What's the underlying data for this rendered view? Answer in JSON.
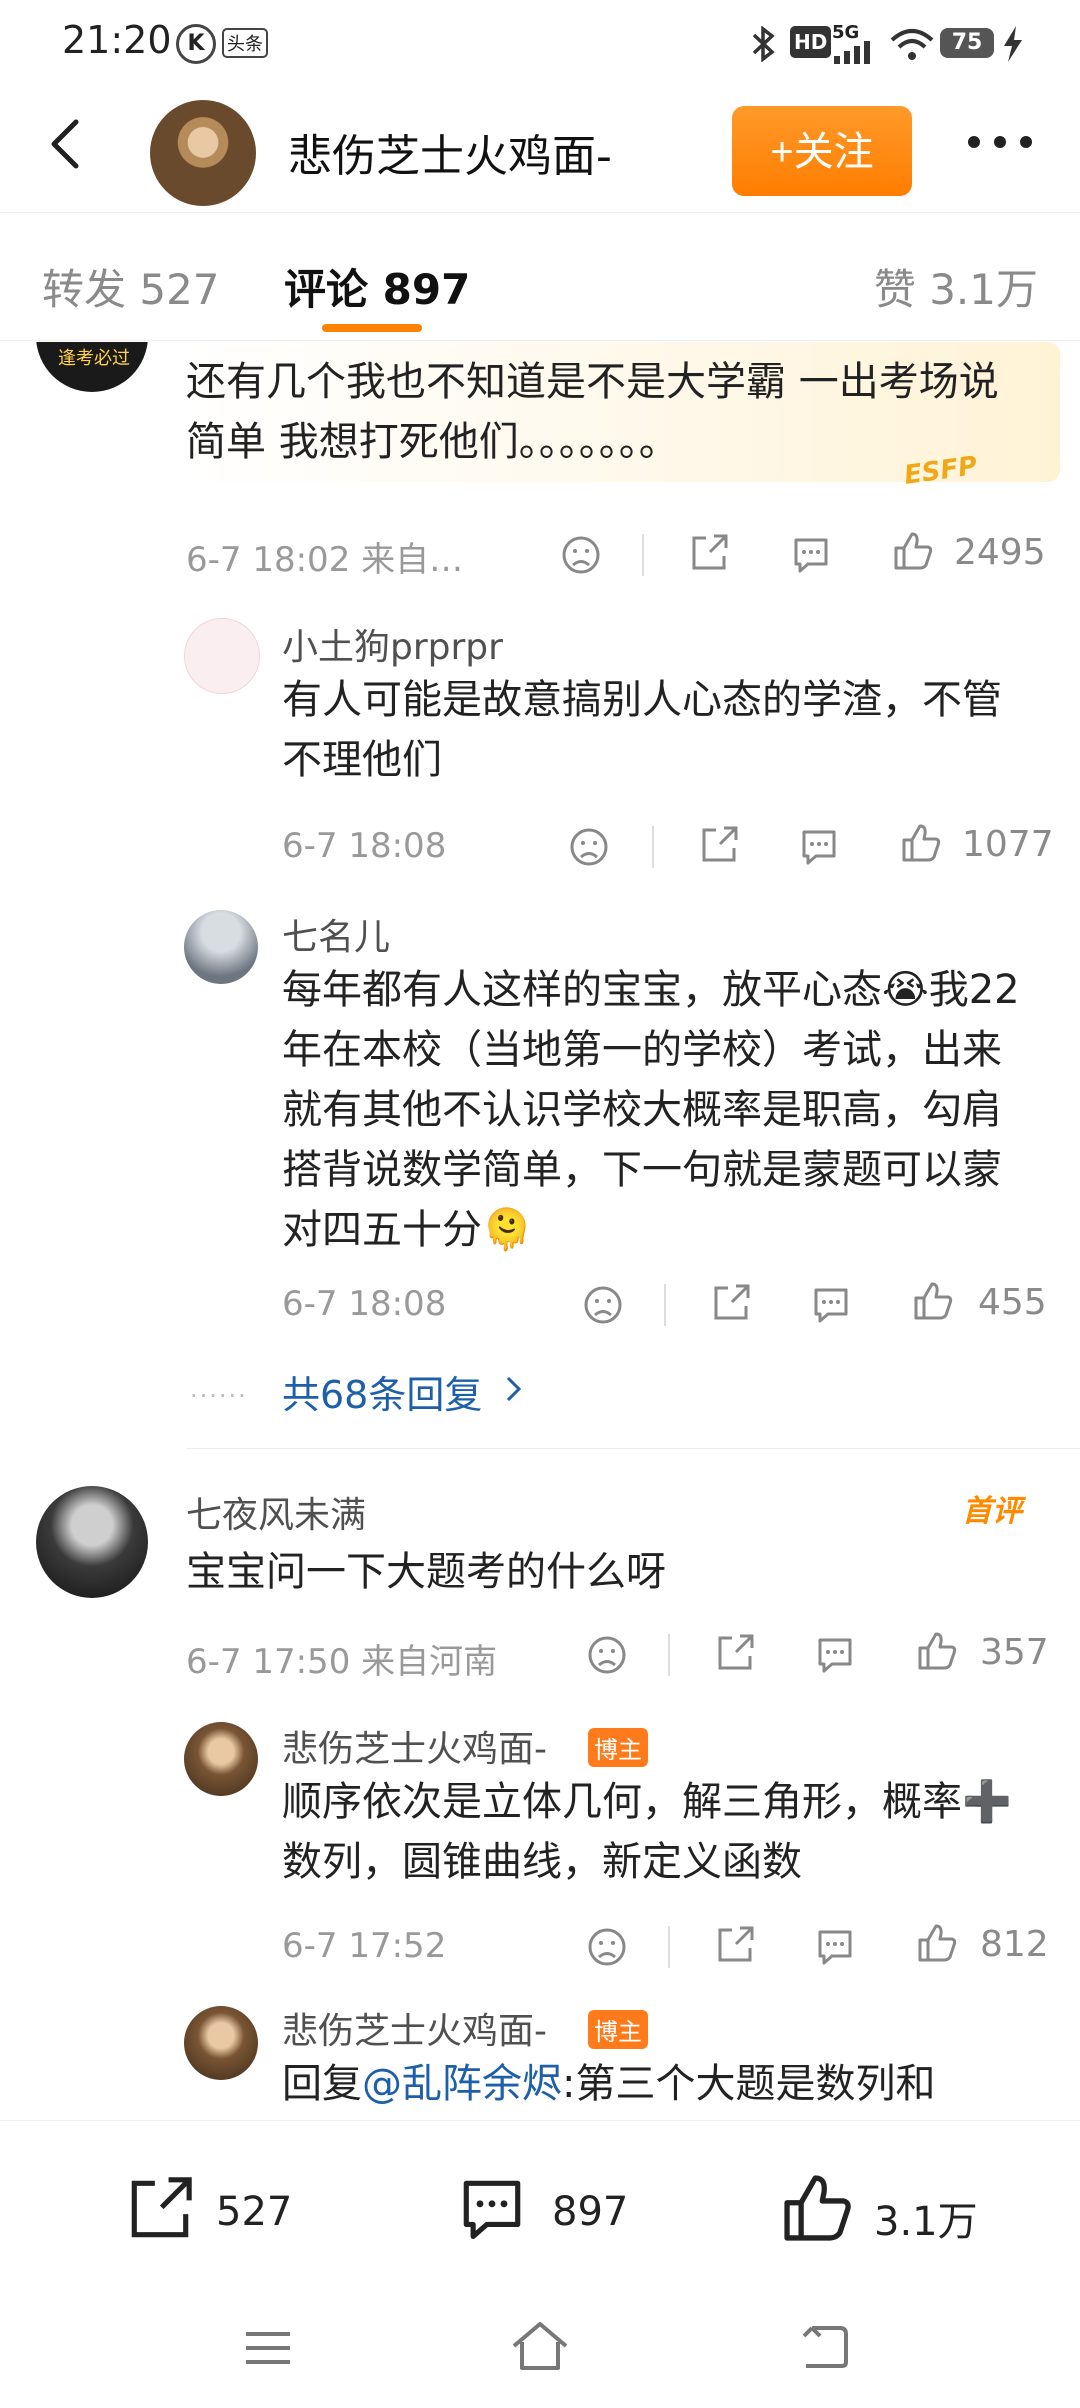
{
  "status": {
    "time": "21:20",
    "notif_k": "K",
    "notif_toutiao": "头条",
    "battery": "75",
    "network": "5G",
    "hd": "HD"
  },
  "header": {
    "title": "悲伤芝士火鸡面-",
    "follow_label": "+关注"
  },
  "tabs": {
    "repost": "转发 527",
    "comment": "评论 897",
    "like": "赞 3.1万"
  },
  "comments": [
    {
      "text": "还有几个我也不知道是不是大学霸 一出考场说简单 我想打死他们。。。。。。。",
      "avatar_text": "逢考必过",
      "sticker": "ESFP",
      "time": "6-7 18:02  来自…",
      "likes": "2495",
      "replies": [
        {
          "name": "小土狗prprpr",
          "text": "有人可能是故意搞别人心态的学渣，不管不理他们",
          "time": "6-7 18:08",
          "likes": "1077"
        },
        {
          "name": "七名儿",
          "text": "每年都有人这样的宝宝，放平心态😭我22年在本校（当地第一的学校）考试，出来就有其他不认识学校大概率是职高，勾肩搭背说数学简单，下一句就是蒙题可以蒙对四五十分🫠",
          "time": "6-7 18:08",
          "likes": "455"
        }
      ],
      "more_replies": "共68条回复"
    },
    {
      "name": "七夜风未满",
      "first_badge": "首评",
      "text": "宝宝问一下大题考的什么呀",
      "time": "6-7 17:50  来自河南",
      "likes": "357",
      "replies": [
        {
          "name": "悲伤芝士火鸡面-",
          "host_badge": "博主",
          "text": "顺序依次是立体几何，解三角形，概率➕数列，圆锥曲线，新定义函数",
          "time": "6-7 17:52",
          "likes": "812"
        },
        {
          "name": "悲伤芝士火鸡面-",
          "host_badge": "博主",
          "reply_prefix": "回复",
          "mention": "@乱阵余烬",
          "text_after": ":第三个大题是数列和"
        }
      ]
    }
  ],
  "bottom": {
    "repost": "527",
    "comment": "897",
    "like": "3.1万"
  },
  "colors": {
    "accent": "#ff8200",
    "link": "#1d5fa8",
    "host_badge": "#ff7a1a"
  }
}
